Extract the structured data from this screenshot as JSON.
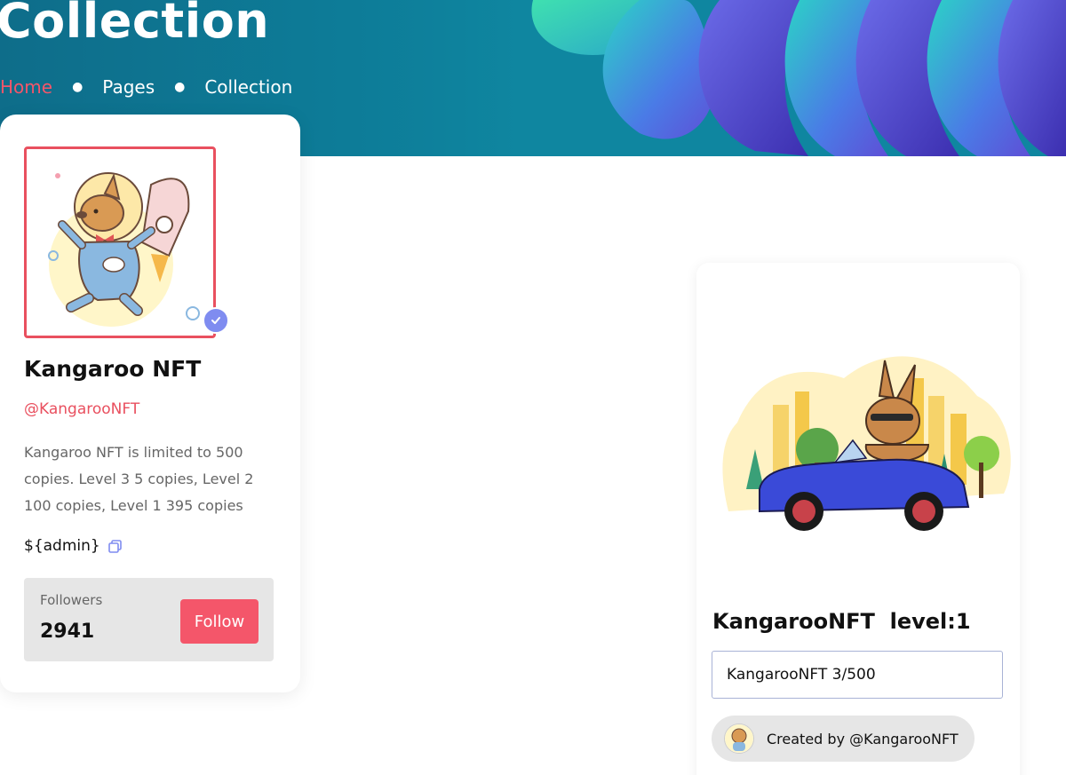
{
  "hero": {
    "title": "Collection",
    "breadcrumb": [
      "Home",
      "Pages",
      "Collection"
    ]
  },
  "profile": {
    "name": "Kangaroo NFT",
    "handle": "@KangarooNFT",
    "description": "Kangaroo NFT is limited to 500 copies. Level 3 5 copies, Level 2 100 copies, Level 1 395 copies",
    "admin": "${admin}",
    "followers_label": "Followers",
    "followers_count": "2941",
    "follow_label": "Follow"
  },
  "nft": {
    "title": "KangarooNFT  level:1",
    "edition": "KangarooNFT 3/500",
    "creator": "Created by @KangarooNFT"
  },
  "colors": {
    "accent": "#f4566a",
    "verified": "#7f8cf0",
    "hero_bg": "#0d7d99"
  },
  "icons": {
    "verified": "check-badge-icon",
    "copy": "copy-icon"
  }
}
